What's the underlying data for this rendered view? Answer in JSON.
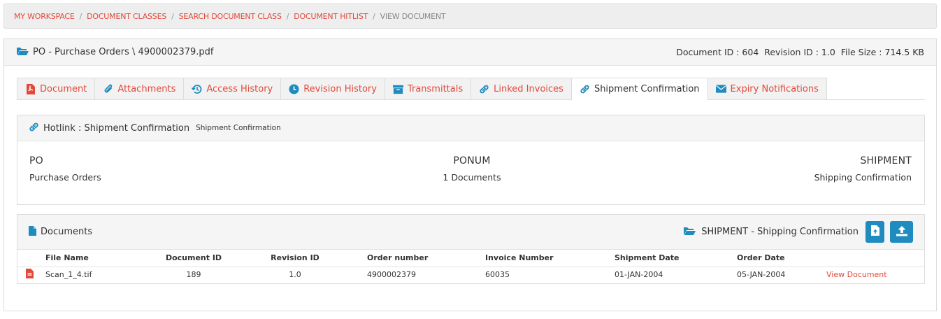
{
  "breadcrumb": [
    "MY WORKSPACE",
    "DOCUMENT CLASSES",
    "SEARCH DOCUMENT CLASS",
    "DOCUMENT HITLIST",
    "VIEW DOCUMENT"
  ],
  "header": {
    "title": "PO - Purchase Orders \\ 4900002379.pdf",
    "meta": "Document ID : 604  Revision ID : 1.0  File Size : 714.5 KB"
  },
  "tabs": [
    {
      "label": "Document",
      "icon": "pdf-icon"
    },
    {
      "label": "Attachments",
      "icon": "paperclip-icon"
    },
    {
      "label": "Access History",
      "icon": "history-icon"
    },
    {
      "label": "Revision History",
      "icon": "clock-icon"
    },
    {
      "label": "Transmittals",
      "icon": "box-icon"
    },
    {
      "label": "Linked Invoices",
      "icon": "link-icon"
    },
    {
      "label": "Shipment Confirmation",
      "icon": "link-icon"
    },
    {
      "label": "Expiry Notifications",
      "icon": "envelope-icon"
    }
  ],
  "hotlink": {
    "title": "Hotlink : Shipment Confirmation",
    "subtitle": "Shipment Confirmation",
    "left": {
      "code": "PO",
      "name": "Purchase Orders"
    },
    "center": {
      "code": "PONUM",
      "count": "1 Documents"
    },
    "right": {
      "code": "SHIPMENT",
      "name": "Shipping Confirmation"
    }
  },
  "documents": {
    "title": "Documents",
    "class_label": "SHIPMENT - Shipping Confirmation",
    "columns": [
      "File Name",
      "Document ID",
      "Revision ID",
      "Order number",
      "Invoice Number",
      "Shipment Date",
      "Order Date"
    ],
    "rows": [
      {
        "file": "Scan_1_4.tif",
        "doc_id": "189",
        "rev": "1.0",
        "order": "4900002379",
        "invoice": "60035",
        "ship": "01-JAN-2004",
        "order_date": "05-JAN-2004",
        "action": "View Document"
      }
    ]
  },
  "colors": {
    "accent": "#e14a3b",
    "primary": "#1f8bbf"
  }
}
